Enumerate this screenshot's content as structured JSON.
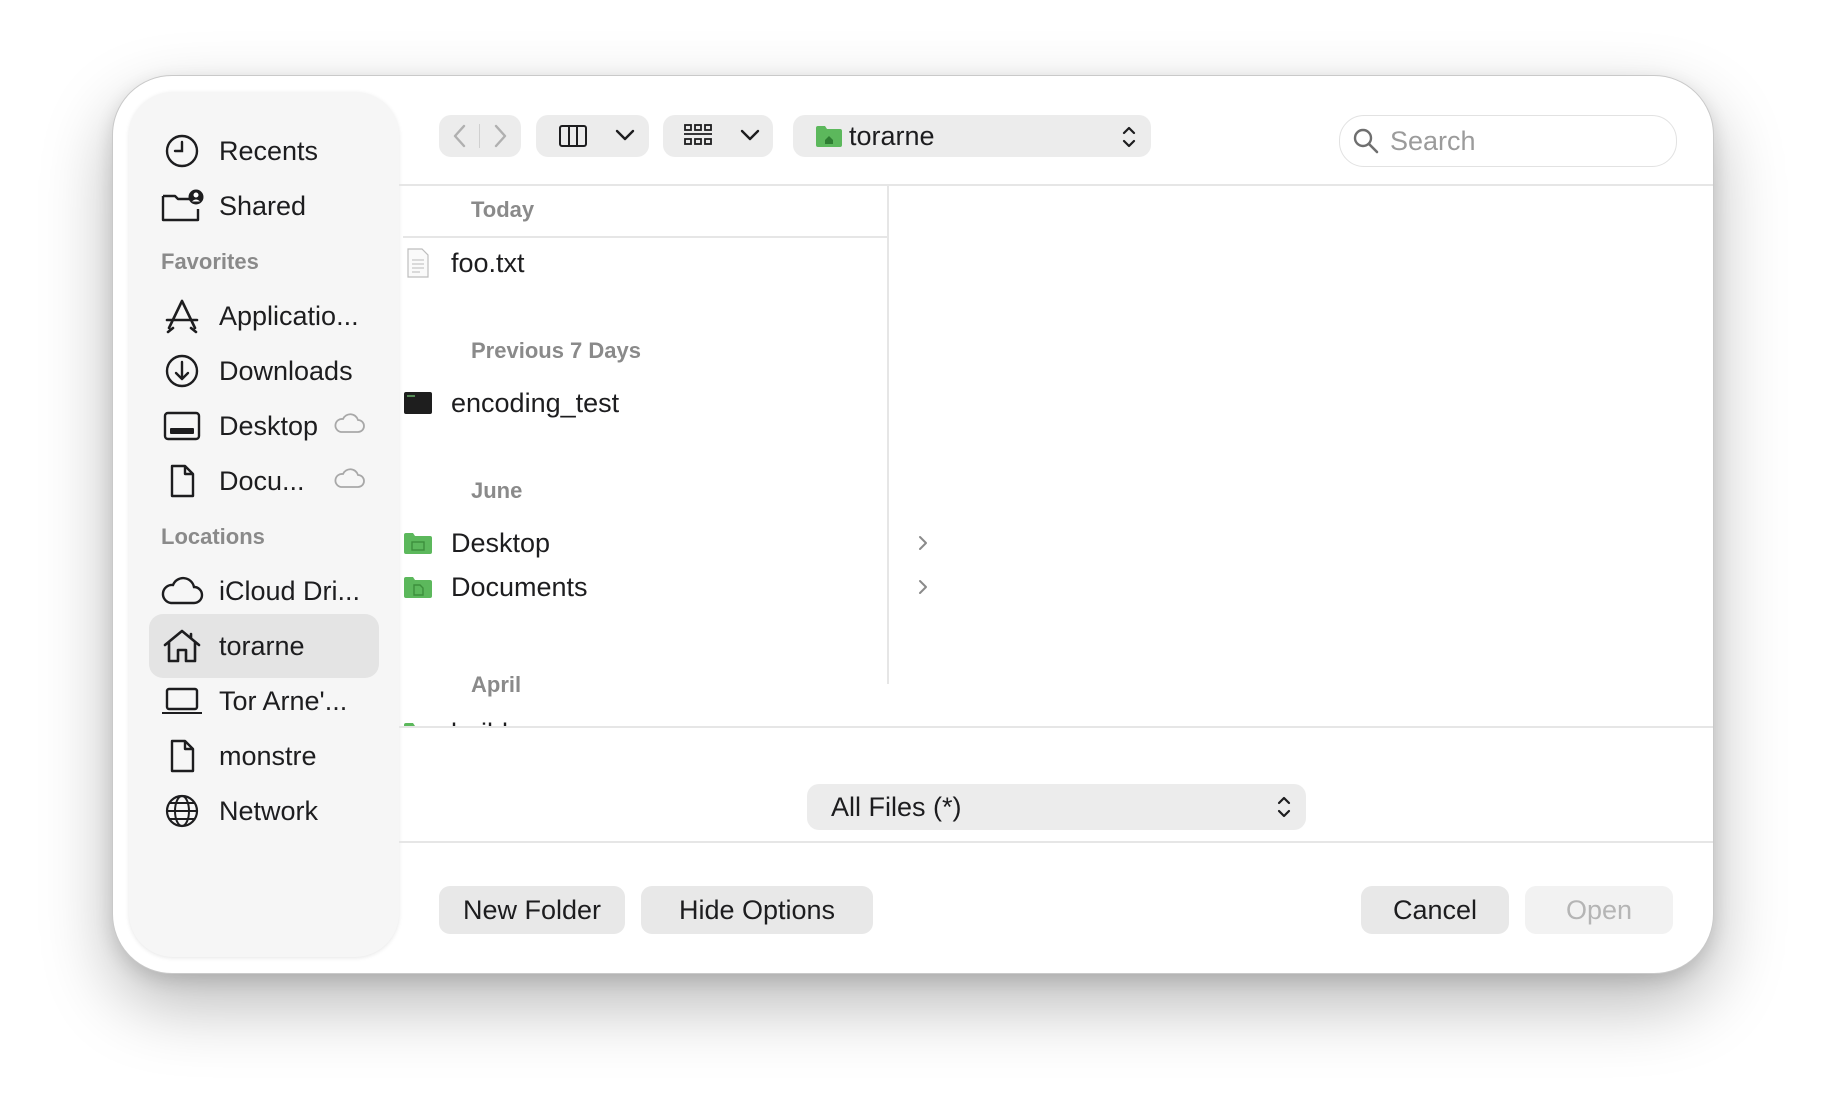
{
  "sidebar": {
    "items_top": [
      {
        "label": "Recents",
        "icon": "clock-icon"
      },
      {
        "label": "Shared",
        "icon": "shared-folder-icon"
      }
    ],
    "favorites_header": "Favorites",
    "favorites": [
      {
        "label": "Applicatio...",
        "icon": "applications-icon"
      },
      {
        "label": "Downloads",
        "icon": "download-icon"
      },
      {
        "label": "Desktop",
        "icon": "desktop-icon",
        "cloud": true
      },
      {
        "label": "Docu...",
        "icon": "document-icon",
        "cloud": true
      }
    ],
    "locations_header": "Locations",
    "locations": [
      {
        "label": "iCloud Dri...",
        "icon": "cloud-icon"
      },
      {
        "label": "torarne",
        "icon": "home-icon",
        "selected": true
      },
      {
        "label": "Tor Arne'...",
        "icon": "laptop-icon"
      },
      {
        "label": "monstre",
        "icon": "document-icon"
      },
      {
        "label": "Network",
        "icon": "globe-icon"
      }
    ]
  },
  "toolbar": {
    "location": "torarne",
    "search_placeholder": "Search"
  },
  "file_list": {
    "groups": [
      {
        "header": "Today",
        "items": [
          {
            "name": "foo.txt",
            "kind": "text-file"
          }
        ]
      },
      {
        "header": "Previous 7 Days",
        "items": [
          {
            "name": "encoding_test",
            "kind": "executable"
          }
        ]
      },
      {
        "header": "June",
        "items": [
          {
            "name": "Desktop",
            "kind": "folder"
          },
          {
            "name": "Documents",
            "kind": "folder"
          }
        ]
      },
      {
        "header": "April",
        "items": [
          {
            "name": "build",
            "kind": "folder"
          }
        ]
      }
    ]
  },
  "filter": {
    "selected": "All Files (*)"
  },
  "buttons": {
    "new_folder": "New Folder",
    "hide_options": "Hide Options",
    "cancel": "Cancel",
    "open": "Open"
  },
  "colors": {
    "folder_green": "#5cb85c",
    "selection": "#e4e4e4",
    "button_bg": "#e8e8e8"
  }
}
